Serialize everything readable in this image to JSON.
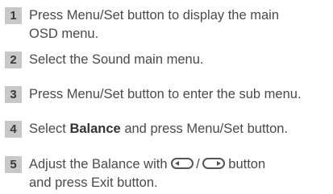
{
  "steps": [
    {
      "number": "1",
      "line1": "Press Menu/Set button to display the main",
      "line2": "OSD menu."
    },
    {
      "number": "2",
      "text": "Select the Sound main menu."
    },
    {
      "number": "3",
      "text": "Press Menu/Set button to enter the sub menu."
    },
    {
      "number": "4",
      "prefix": "Select ",
      "bold": "Balance",
      "suffix": " and press Menu/Set button."
    },
    {
      "number": "5",
      "prefix": "Adjust the Balance with ",
      "separator": "/",
      "suffix": " button",
      "line2": "and press Exit button.",
      "icons": [
        "left-arrow-button-icon",
        "right-arrow-button-icon"
      ]
    }
  ]
}
